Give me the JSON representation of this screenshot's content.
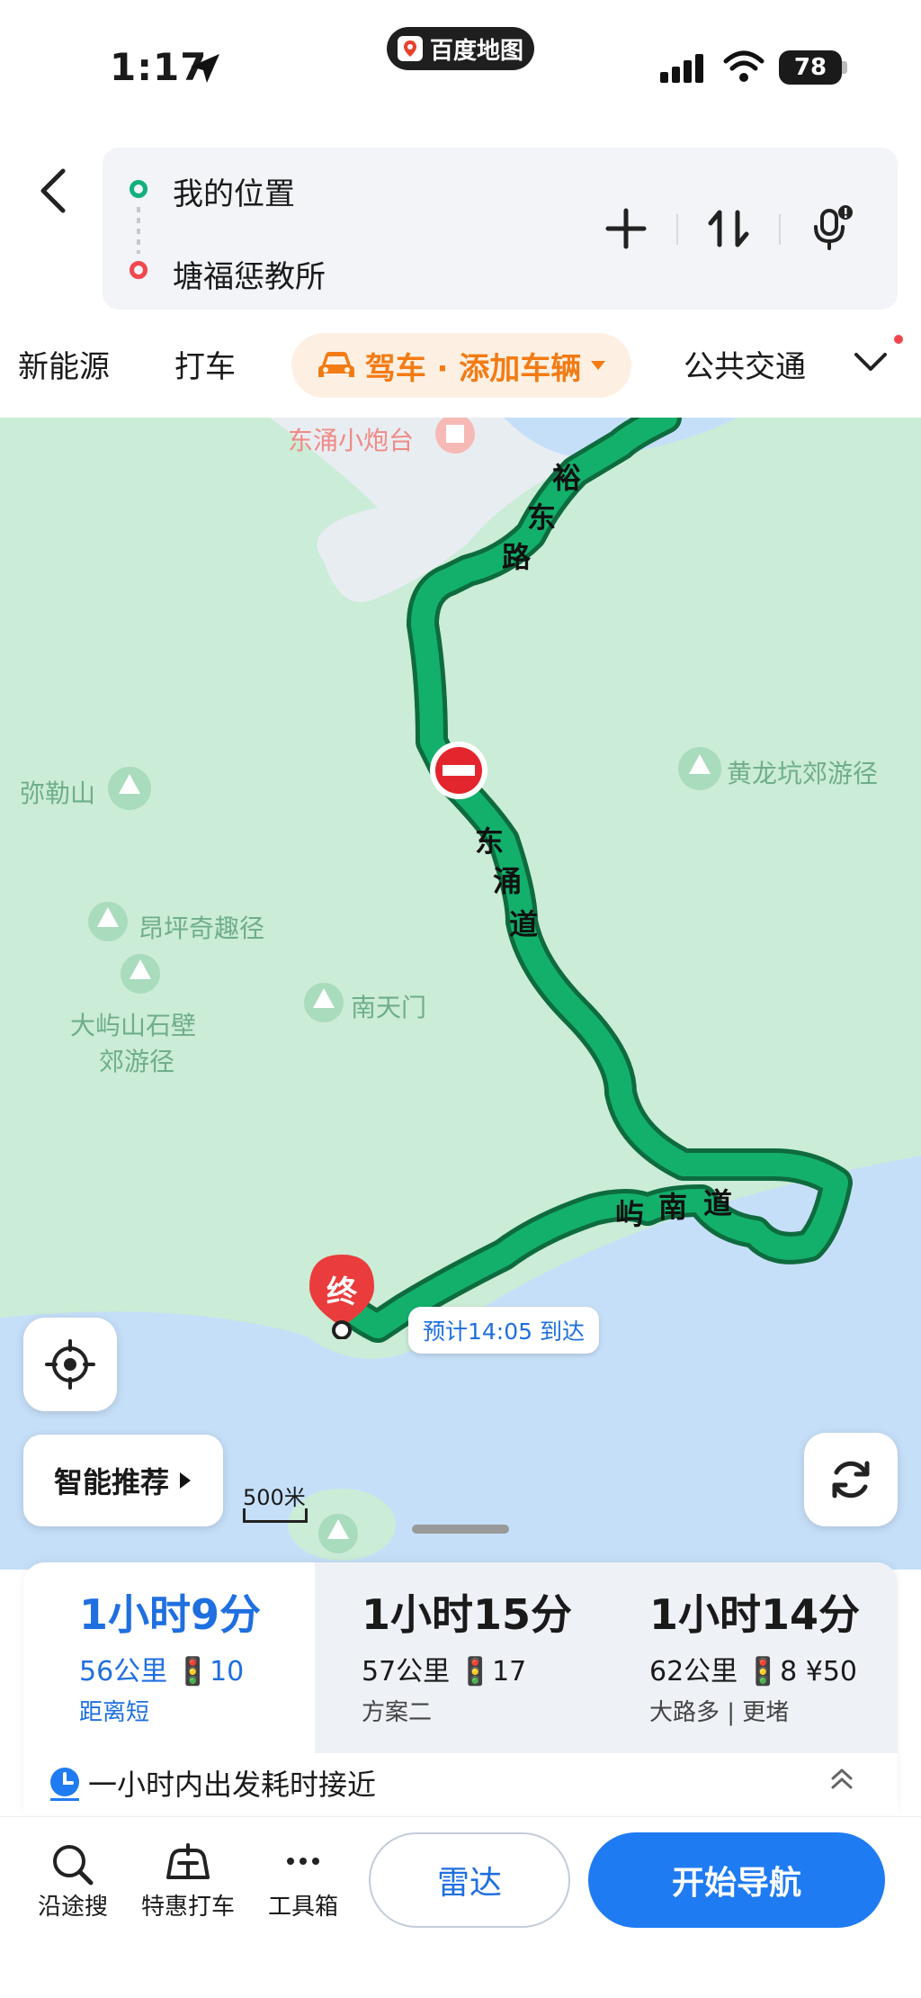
{
  "status_bar": {
    "time": "1:17",
    "app_pill": "百度地图",
    "battery": "78"
  },
  "search": {
    "start": "我的位置",
    "end": "塘福惩教所"
  },
  "tabs": {
    "items": [
      "新能源",
      "打车",
      "驾车 · 添加车辆",
      "公共交通"
    ],
    "active": "驾车 · 添加车辆"
  },
  "map": {
    "pois": [
      "东涌小炮台",
      "弥勒山",
      "黄龙坑郊游径",
      "昂坪奇趣径",
      "大屿山石壁",
      "郊游径",
      "南天门"
    ],
    "roads": [
      "裕",
      "东",
      "路",
      "东",
      "涌",
      "道",
      "屿",
      "南",
      "道"
    ],
    "end_marker": "终",
    "eta": "预计14:05 到达",
    "smart_button": "智能推荐",
    "scale": "500米"
  },
  "routes": [
    {
      "duration": "1小时9分",
      "distance": "56公里",
      "lights": "10",
      "tag": "距离短",
      "selected": true
    },
    {
      "duration": "1小时15分",
      "distance": "57公里",
      "lights": "17",
      "tag": "方案二",
      "selected": false
    },
    {
      "duration": "1小时14分",
      "distance": "62公里",
      "lights": "8",
      "toll": "¥50",
      "tag": "大路多 | 更堵",
      "selected": false
    }
  ],
  "note": "一小时内出发耗时接近",
  "bottom_bar": {
    "along": "沿途搜",
    "taxi": "特惠打车",
    "tools": "工具箱",
    "radar": "雷达",
    "navigate": "开始导航"
  },
  "colors": {
    "route_green": "#13b06b",
    "accent_blue": "#1f7bf2",
    "drive_orange": "#f37b14",
    "map_green": "#cbecd7",
    "water_blue": "#c6dff8"
  }
}
